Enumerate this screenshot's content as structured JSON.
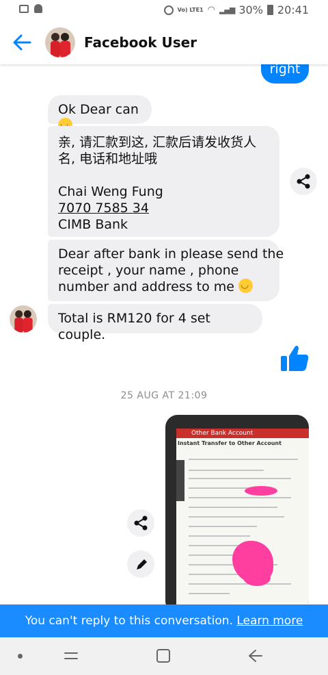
{
  "status_bar": {
    "battery": "30%",
    "time": "20:41",
    "network": "Vo) LTE1"
  },
  "header": {
    "title": "Facebook User"
  },
  "messages": {
    "sent_top": "right",
    "m1": "Ok Dear can",
    "m2_lines": [
      "亲, 请汇款到这, 汇款后请发收货人",
      "名, 电话和地址哦",
      "",
      "Chai Weng Fung",
      "7070 7585 34",
      "CIMB Bank"
    ],
    "m3_lines": [
      "Dear after bank in please send the",
      "receipt , your name , phone",
      "number and address to me"
    ],
    "m4": "Total is RM120 for 4 set couple."
  },
  "timestamp": "25 AUG AT 21:09",
  "shared_image": {
    "bar_title": "Other Bank Account",
    "subtitle": "Instant Transfer to Other Account"
  },
  "footer": {
    "text": "You can't reply to this conversation.",
    "link": "Learn more"
  },
  "colors": {
    "accent": "#0084ff",
    "footer": "#1a8cff",
    "bubble": "#efeff2"
  }
}
